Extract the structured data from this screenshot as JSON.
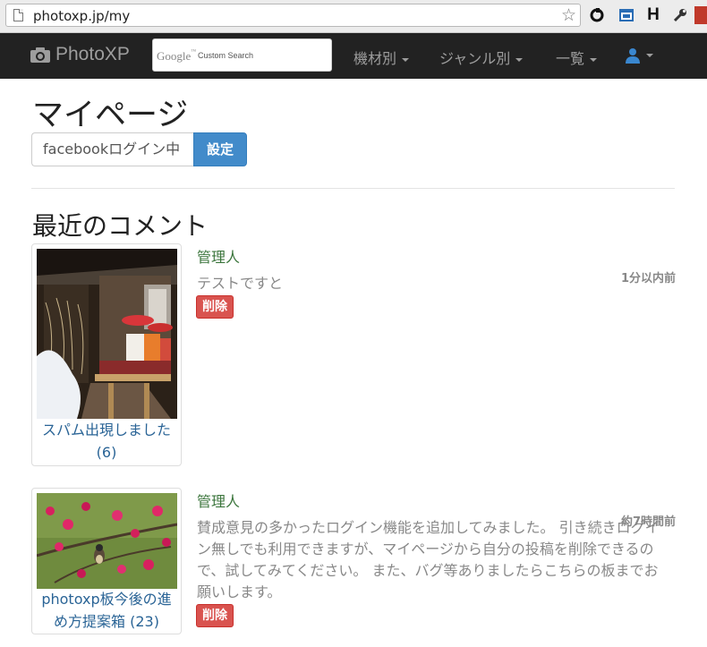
{
  "browser": {
    "url": "photoxp.jp/my"
  },
  "navbar": {
    "brand": "PhotoXP",
    "search_logo": "Google",
    "search_placeholder": "Custom Search",
    "menu": [
      {
        "label": "機材別"
      },
      {
        "label": "ジャンル別"
      },
      {
        "label": "一覧"
      }
    ]
  },
  "page": {
    "title": "マイページ",
    "login_status": "facebookログイン中",
    "settings_button": "設定",
    "recent_comments_heading": "最近のコメント"
  },
  "comments": [
    {
      "thread_title": "スパム出現しました",
      "thread_count": "(6)",
      "author": "管理人",
      "time": "1分以内前",
      "text": "テストですと",
      "delete_label": "削除"
    },
    {
      "thread_title": "photoxp板今後の進め方提案箱",
      "thread_count": "(23)",
      "author": "管理人",
      "time": "約7時間前",
      "text": "賛成意見の多かったログイン機能を追加してみました。 引き続きログイン無しでも利用できますが、マイページから自分の投稿を削除できるので、試してみてください。 また、バグ等ありましたらこちらの板までお願いします。",
      "delete_label": "削除"
    }
  ],
  "colors": {
    "navbar_bg": "#222222",
    "primary": "#428bca",
    "danger": "#d9534f",
    "author_green": "#3c763d",
    "link": "#2a6496"
  }
}
